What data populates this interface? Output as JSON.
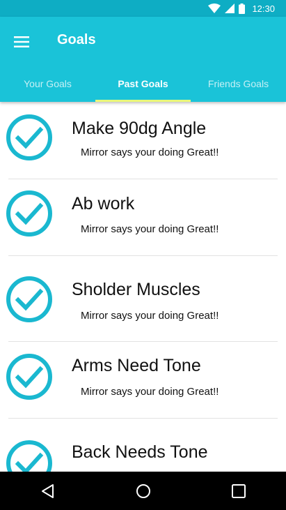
{
  "status_bar": {
    "time": "12:30",
    "icons": [
      "wifi-icon",
      "signal-icon",
      "battery-icon"
    ],
    "color": "#0eadc4"
  },
  "app_bar": {
    "title": "Goals",
    "menu_icon": "hamburger-menu-icon",
    "color": "#1ac3d8"
  },
  "tabs": [
    {
      "label": "Your Goals",
      "active": false
    },
    {
      "label": "Past Goals",
      "active": true
    },
    {
      "label": "Friends Goals",
      "active": false
    }
  ],
  "tab_indicator_color": "#e9f77a",
  "goals": [
    {
      "title": "Make 90dg Angle",
      "subtitle": "Mirror says your doing Great!!",
      "icon": "check-circle-icon",
      "completed": true
    },
    {
      "title": "Ab work",
      "subtitle": "Mirror says your doing Great!!",
      "icon": "check-circle-icon",
      "completed": true
    },
    {
      "title": "Sholder Muscles",
      "subtitle": "Mirror says your doing Great!!",
      "icon": "check-circle-icon",
      "completed": true
    },
    {
      "title": "Arms Need Tone",
      "subtitle": "Mirror says your doing Great!!",
      "icon": "check-circle-icon",
      "completed": true
    },
    {
      "title": "Back Needs Tone",
      "subtitle": "",
      "icon": "check-circle-icon",
      "completed": true
    }
  ],
  "check_color": "#1ab8d0",
  "nav_bar": {
    "buttons": [
      "back-icon",
      "home-icon",
      "recents-icon"
    ]
  }
}
